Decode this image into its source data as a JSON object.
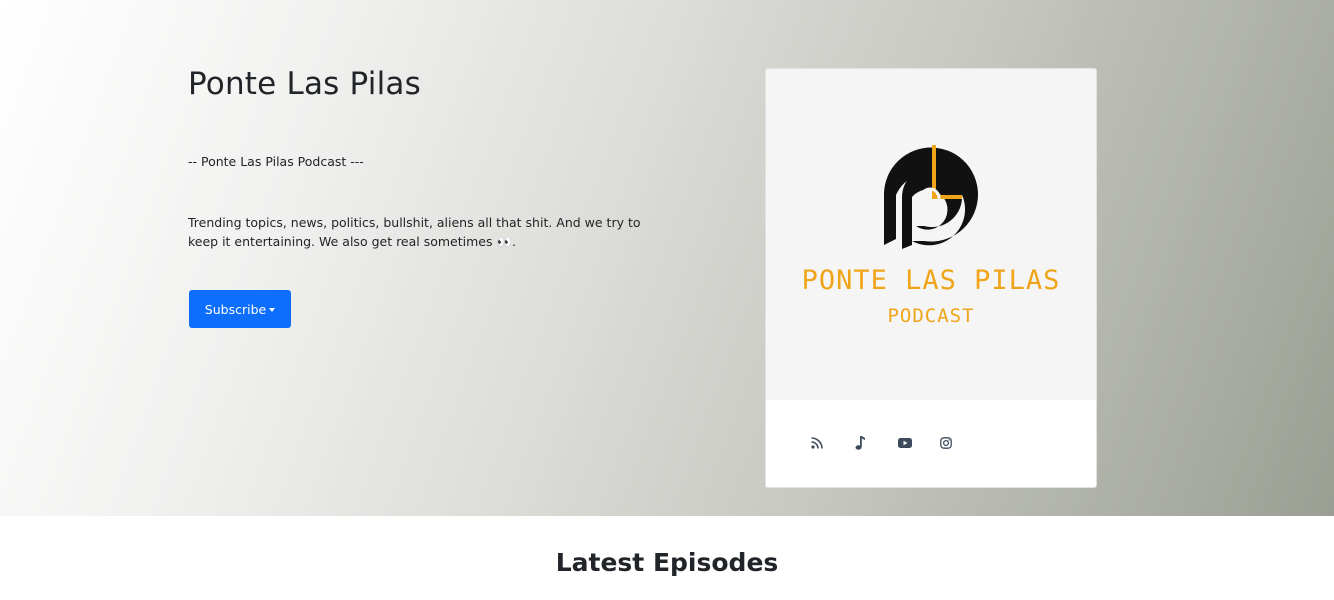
{
  "hero": {
    "title": "Ponte Las Pilas",
    "tagline": "-- Ponte Las Pilas Podcast ---",
    "description": "Trending topics, news, politics, bullshit, aliens all that shit. And we try to keep it entertaining. We also get real sometimes 👀.",
    "subscribe_label": "Subscribe"
  },
  "cover": {
    "line1": "PONTE LAS PILAS",
    "line2": "PODCAST",
    "accent_color": "#f0a519",
    "mark_color": "#111111"
  },
  "links": [
    {
      "icon": "rss-icon"
    },
    {
      "icon": "music-note-icon"
    },
    {
      "icon": "youtube-icon"
    },
    {
      "icon": "instagram-icon"
    }
  ],
  "main": {
    "section_title": "Latest Episodes"
  },
  "colors": {
    "primary": "#0d6efd",
    "icon": "#3d4a5c"
  }
}
